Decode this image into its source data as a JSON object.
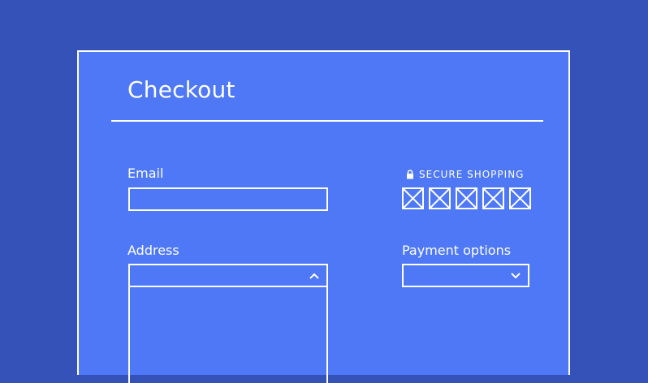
{
  "colors": {
    "background": "#3452b8",
    "panel": "#4e78f6",
    "line": "#ffffff"
  },
  "form": {
    "title": "Checkout",
    "email": {
      "label": "Email",
      "value": ""
    },
    "address": {
      "label": "Address",
      "value": "",
      "icon": "chevron-up-icon"
    },
    "secure": {
      "text": "SECURE SHOPPING",
      "icon": "lock-icon",
      "badge_count": 5
    },
    "payment": {
      "label": "Payment options",
      "value": "",
      "icon": "chevron-down-icon"
    }
  }
}
